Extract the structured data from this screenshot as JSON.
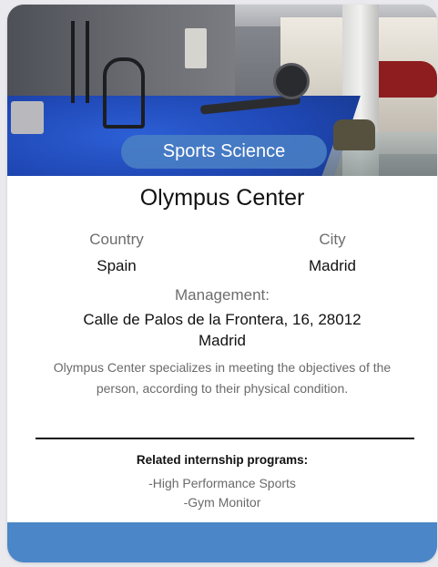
{
  "card": {
    "category_tag": "Sports Science",
    "hero_image_desc_icon": "gym-photo",
    "title": "Olympus Center",
    "country_label": "Country",
    "country_value": "Spain",
    "city_label": "City",
    "city_value": "Madrid",
    "management_label": "Management:",
    "management_value": "Calle de Palos de la Frontera, 16, 28012 Madrid",
    "description": "Olympus Center specializes in meeting the objectives of the person, according to their physical condition.",
    "related_title": "Related internship programs:",
    "related_programs": [
      "-High Performance Sports",
      "-Gym Monitor"
    ]
  },
  "colors": {
    "accent": "#4a86c8",
    "tag_background": "#4a80c4",
    "title_text": "#111111",
    "muted_text": "#6d6d6d"
  }
}
